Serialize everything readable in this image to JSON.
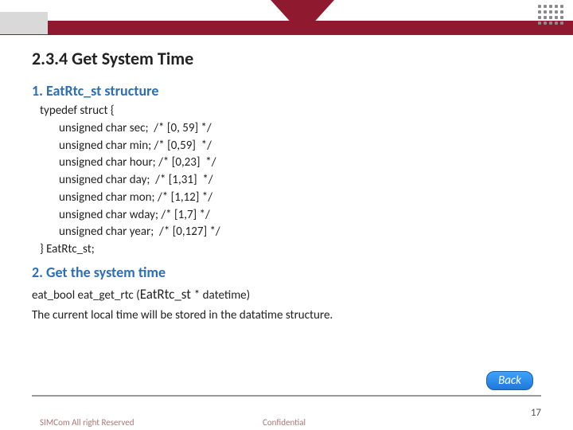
{
  "header": {
    "title": "2.3.4 Get System Time"
  },
  "section1": {
    "heading": "1. EatRtc_st structure",
    "code": {
      "l0": "typedef struct {",
      "l1": "unsigned char sec;  /* [0, 59] */",
      "l2": "unsigned char min; /* [0,59]  */",
      "l3": "unsigned char hour; /* [0,23]  */",
      "l4": "unsigned char day;  /* [1,31]  */",
      "l5": "unsigned char mon; /* [1,12] */",
      "l6": "unsigned char wday; /* [1,7] */",
      "l7": "unsigned char year;  /* [0,127] */",
      "l8": "} EatRtc_st;"
    }
  },
  "section2": {
    "heading": "2. Get the system time",
    "sig_prefix": "eat_bool eat_get_rtc (",
    "sig_type": "EatRtc_st ",
    "sig_suffix": "* datetime)",
    "desc": "The current local time will be stored in the datatime structure."
  },
  "nav": {
    "back": "Back"
  },
  "footer": {
    "copyright": "SIMCom All right Reserved",
    "confidential": "Confidential",
    "page": "17"
  }
}
